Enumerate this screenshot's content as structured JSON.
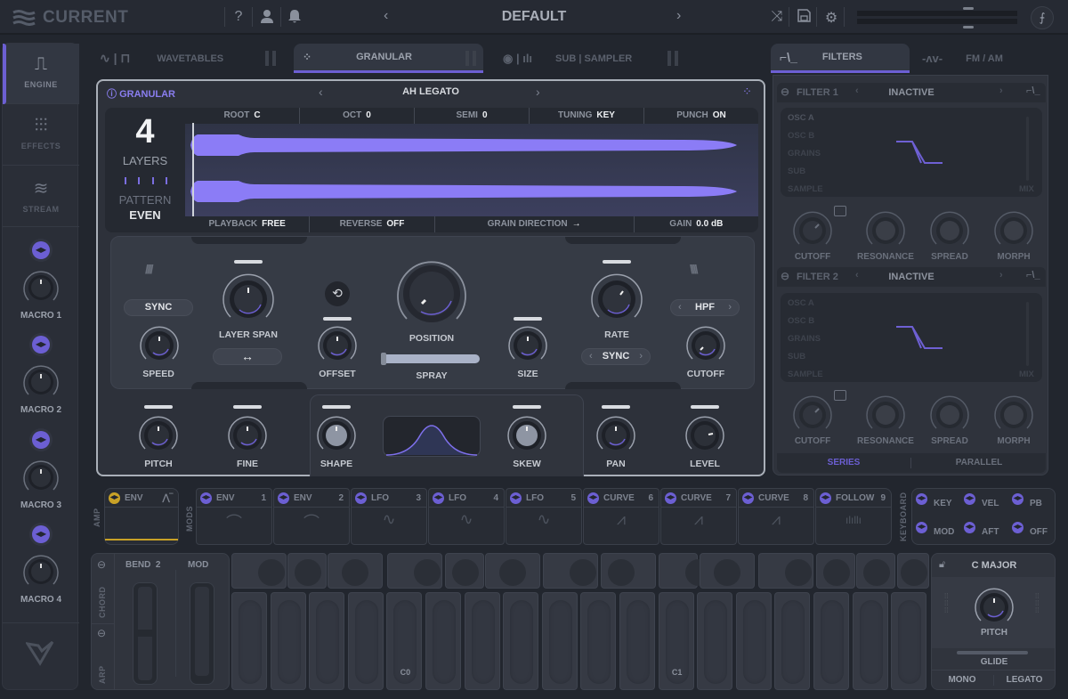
{
  "topbar": {
    "app_name": "CURRENT",
    "preset_name": "DEFAULT",
    "prev_arrow": "‹",
    "next_arrow": "›",
    "icons": [
      "help-icon",
      "user-icon",
      "bell-icon",
      "shuffle-icon",
      "save-icon",
      "gear-icon",
      "curve-icon"
    ]
  },
  "sidebar": {
    "nav": [
      {
        "label": "ENGINE",
        "icon": "square-wave-icon",
        "active": true
      },
      {
        "label": "EFFECTS",
        "icon": "sliders-icon",
        "active": false
      },
      {
        "label": "STREAM",
        "icon": "stream-icon",
        "active": false
      }
    ],
    "macros": [
      {
        "label": "MACRO 1"
      },
      {
        "label": "MACRO 2"
      },
      {
        "label": "MACRO 3"
      },
      {
        "label": "MACRO 4"
      }
    ]
  },
  "osc_tabs": [
    {
      "label": "WAVETABLES",
      "active": false
    },
    {
      "label": "GRANULAR",
      "active": true
    },
    {
      "label": "SUB | SAMPLER",
      "active": false
    }
  ],
  "right_tabs": [
    {
      "label": "FILTERS",
      "active": true
    },
    {
      "label": "FM / AM",
      "active": false
    }
  ],
  "granular": {
    "title": "GRANULAR",
    "preset": "AH LEGATO",
    "layers_count": "4",
    "layers_label": "LAYERS",
    "pattern_label": "PATTERN",
    "pattern_value": "EVEN",
    "top_params": [
      {
        "label": "ROOT",
        "value": "C"
      },
      {
        "label": "OCT",
        "value": "0"
      },
      {
        "label": "SEMI",
        "value": "0"
      },
      {
        "label": "TUNING",
        "value": "KEY"
      },
      {
        "label": "PUNCH",
        "value": "ON"
      }
    ],
    "bottom_params": [
      {
        "label": "PLAYBACK",
        "value": "FREE"
      },
      {
        "label": "REVERSE",
        "value": "OFF"
      },
      {
        "label": "GRAIN DIRECTION",
        "value": "→"
      },
      {
        "label": "GAIN",
        "value": "0.0 dB"
      }
    ],
    "controls": {
      "sync_button": "SYNC",
      "speed": "SPEED",
      "layer_span": "LAYER SPAN",
      "span_button": "↔",
      "offset": "OFFSET",
      "position": "POSITION",
      "spray": "SPRAY",
      "size": "SIZE",
      "rate": "RATE",
      "rate_mode": "SYNC",
      "filter_type": "HPF",
      "cutoff": "CUTOFF"
    },
    "lower": {
      "pitch": "PITCH",
      "fine": "FINE",
      "shape": "SHAPE",
      "skew": "SKEW",
      "pan": "PAN",
      "level": "LEVEL"
    }
  },
  "filters": [
    {
      "title": "FILTER 1",
      "type": "INACTIVE",
      "sources": [
        "OSC A",
        "OSC B",
        "GRAINS",
        "SUB",
        "SAMPLE"
      ],
      "mix": "MIX",
      "knobs": [
        "CUTOFF",
        "RESONANCE",
        "SPREAD",
        "MORPH"
      ]
    },
    {
      "title": "FILTER 2",
      "type": "INACTIVE",
      "sources": [
        "OSC A",
        "OSC B",
        "GRAINS",
        "SUB",
        "SAMPLE"
      ],
      "mix": "MIX",
      "knobs": [
        "CUTOFF",
        "RESONANCE",
        "SPREAD",
        "MORPH"
      ]
    }
  ],
  "routing": {
    "series": "SERIES",
    "parallel": "PARALLEL",
    "active": "SERIES"
  },
  "mods": {
    "amp_label": "AMP",
    "mods_label": "MODS",
    "keyboard_label": "KEYBOARD",
    "amp": {
      "name": "ENV"
    },
    "slots": [
      {
        "name": "ENV",
        "num": "1",
        "glyph": "⌒"
      },
      {
        "name": "ENV",
        "num": "2",
        "glyph": "⌒"
      },
      {
        "name": "LFO",
        "num": "3",
        "glyph": "∿"
      },
      {
        "name": "LFO",
        "num": "4",
        "glyph": "∿"
      },
      {
        "name": "LFO",
        "num": "5",
        "glyph": "∿"
      },
      {
        "name": "CURVE",
        "num": "6",
        "glyph": "⩘"
      },
      {
        "name": "CURVE",
        "num": "7",
        "glyph": "⩘"
      },
      {
        "name": "CURVE",
        "num": "8",
        "glyph": "⩘"
      },
      {
        "name": "FOLLOW",
        "num": "9",
        "glyph": "ılıllı"
      }
    ],
    "keyboard": [
      "KEY",
      "VEL",
      "PB",
      "MOD",
      "AFT",
      "OFF"
    ]
  },
  "perf": {
    "chord": "CHORD",
    "arp": "ARP",
    "bend_label": "BEND",
    "bend_value": "2",
    "mod_label": "MOD"
  },
  "keys": {
    "c0": "C0",
    "c1": "C1"
  },
  "scale": {
    "name": "C  MAJOR",
    "pitch": "PITCH",
    "glide": "GLIDE",
    "mono": "MONO",
    "legato": "LEGATO"
  },
  "colors": {
    "accent": "#6c5fd3",
    "amp_accent": "#c9a227",
    "waveform": "#8b7cf6"
  }
}
